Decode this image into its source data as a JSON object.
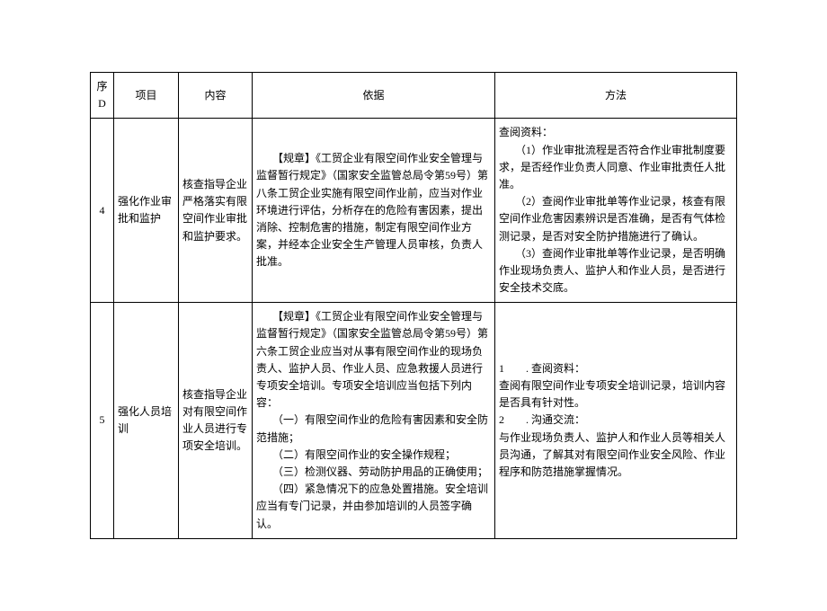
{
  "headers": {
    "seq": "序D",
    "project": "项目",
    "content": "内容",
    "basis": "依据",
    "method": "方法"
  },
  "rows": [
    {
      "seq": "4",
      "project": "强化作业审批和监护",
      "content": "核查指导企业严格落实有限空间作业审批和监护要求。",
      "basis": "　　【规章】《工贸企业有限空间作业安全管理与监督暂行规定》（国家安全监管总局令第59号）第八条工贸企业实施有限空间作业前，应当对作业环境进行评估，分析存在的危险有害因素，提出消除、控制危害的措施，制定有限空间作业方案，并经本企业安全生产管理人员审核，负责人批准。",
      "method": "查阅资料：\n　　（1）作业审批流程是否符合作业审批制度要求，是否经作业负责人同意、作业审批责任人批准。\n　　（2）查阅作业审批单等作业记录，核查有限空间作业危害因素辨识是否准确，是否有气体检测记录，是否对安全防护措施进行了确认。\n　　（3）查阅作业审批单等作业记录，是否明确作业现场负责人、监护人和作业人员，是否进行安全技术交底。"
    },
    {
      "seq": "5",
      "project": "强化人员培训",
      "content": "核查指导企业对有限空间作业人员进行专项安全培训。",
      "basis": "　　【规章】《工贸企业有限空间作业安全管理与监督暂行规定》（国家安全监管总局令第59号）第六条工贸企业应当对从事有限空间作业的现场负责人、监护人员、作业人员、应急救援人员进行专项安全培训。专项安全培训应当包括下列内容：\n　　（一）有限空间作业的危险有害因素和安全防范措施；\n　　（二）有限空间作业的安全操作规程；\n　　（三）检测仪器、劳动防护用品的正确使用；\n　　（四）紧急情况下的应急处置措施。安全培训应当有专门记录，并由参加培训的人员签字确认。",
      "method": "1　　. 查阅资料：\n查阅有限空间作业专项安全培训记录，培训内容是否具有针对性。\n2　　. 沟通交流：\n与作业现场负责人、监护人和作业人员等相关人员沟通，了解其对有限空间作业安全风险、作业程序和防范措施掌握情况。"
    }
  ]
}
